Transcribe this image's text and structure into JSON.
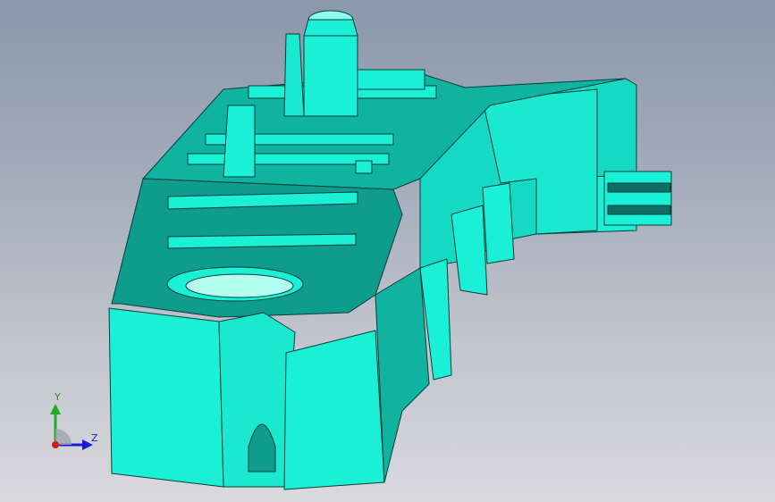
{
  "viewport": {
    "background_top": "#8b97ab",
    "background_bottom": "#d9d9de"
  },
  "model": {
    "body_color": "#19f0d6",
    "shade_color": "#0fb3a0",
    "dark_color": "#0b6f66",
    "edge_color": "#0a3d38"
  },
  "triad": {
    "y_label": "Y",
    "z_label": "Z",
    "y_color": "#22aa22",
    "z_color": "#1b1bd6",
    "x_color": "#d81b1b"
  }
}
